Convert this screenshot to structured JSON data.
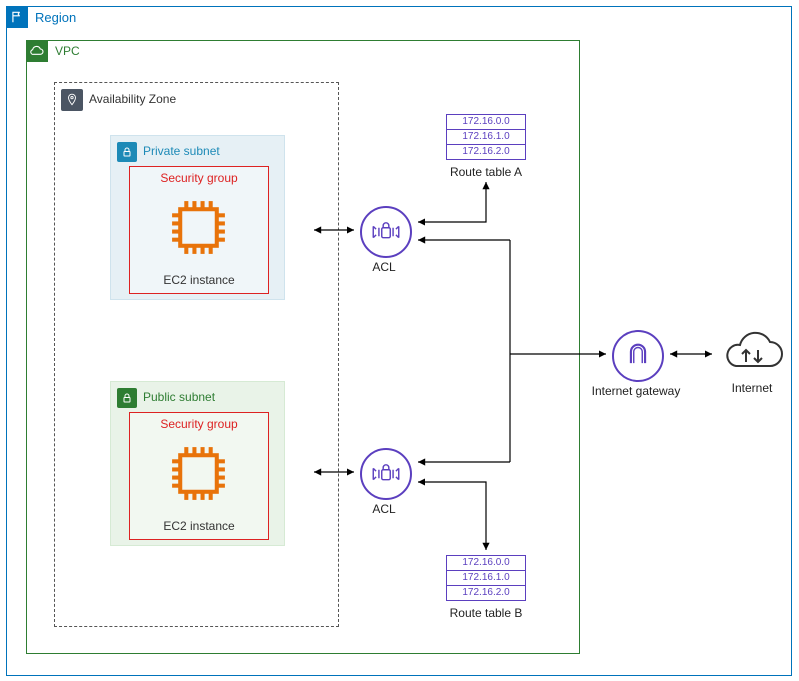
{
  "region": {
    "label": "Region"
  },
  "vpc": {
    "label": "VPC"
  },
  "az": {
    "label": "Availability Zone"
  },
  "private_subnet": {
    "label": "Private subnet",
    "sec_group": "Security group",
    "ec2": "EC2 instance"
  },
  "public_subnet": {
    "label": "Public subnet",
    "sec_group": "Security group",
    "ec2": "EC2 instance"
  },
  "route_table_a": {
    "label": "Route table A",
    "rows": [
      "172.16.0.0",
      "172.16.1.0",
      "172.16.2.0"
    ]
  },
  "route_table_b": {
    "label": "Route table B",
    "rows": [
      "172.16.0.0",
      "172.16.1.0",
      "172.16.2.0"
    ]
  },
  "acl1": {
    "label": "ACL"
  },
  "acl2": {
    "label": "ACL"
  },
  "igw": {
    "label": "Internet gateway"
  },
  "internet": {
    "label": "Internet"
  }
}
